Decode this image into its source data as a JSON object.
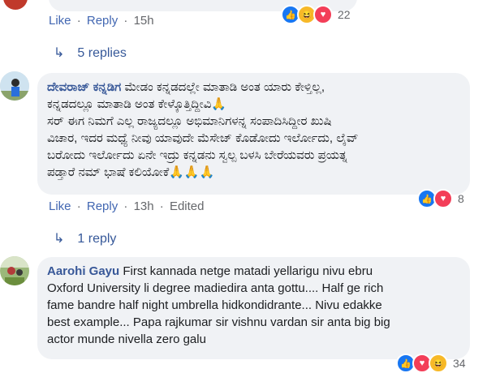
{
  "comment0": {
    "actions": {
      "like": "Like",
      "reply": "Reply",
      "time": "15h"
    },
    "reactions": {
      "count": "22",
      "types": [
        "like-icon",
        "haha-icon",
        "love-icon"
      ]
    },
    "replies_label": "5 replies"
  },
  "comment1": {
    "author": "ದೇವರಾಜ್ ಕನ್ನಡಿಗ",
    "line1": "ಮೇಡಂ ಕನ್ನಡದಲ್ಲೇ ಮಾತಾಡಿ ಅಂತ ಯಾರು ಕೇಳ್ತಿಲ್ಲ,",
    "line2": "ಕನ್ನಡದಲ್ಲೂ ಮಾತಾಡಿ ಅಂತ ಕೇಳ್ಕೊತ್ತಿದ್ದೀವಿ🙏",
    "line3": "ಸರ್ ಈಗ ನಿಮಗೆ ಎಲ್ಲ ರಾಜ್ಯದಲ್ಲೂ ಅಭಿಮಾನಿಗಳನ್ನ ಸಂಪಾದಿಸಿದ್ದೀರ ಖುಷಿ",
    "line4": "ವಿಚಾರ, ಇದರ ಮಧ್ಯೆ ನೀವು ಯಾವುದೇ ಮೆಸೇಜ್ ಕೊಡೋದು ಇರ್ಲೋದು, ಲೈವ್",
    "line5": "ಬರೋದು ಇರ್ಲೋದು ಏನೇ ಇದ್ರು ಕನ್ನಡನು ಸ್ವಲ್ಪ ಬಳಸಿ ಬೇರೆಯವರು ಪ್ರಯತ್ನ",
    "line6": "ಪಡ್ತಾರೆ ನಮ್ ಭಾಷೆ ಕಲಿಯೋಕೆ🙏🙏🙏",
    "actions": {
      "like": "Like",
      "reply": "Reply",
      "time": "13h",
      "edited": "Edited"
    },
    "reactions": {
      "count": "8",
      "types": [
        "like-icon",
        "love-icon"
      ]
    },
    "replies_label": "1 reply"
  },
  "comment2": {
    "author": "Aarohi Gayu",
    "line1": "First kannada netge matadi yellarigu nivu ebru",
    "line2": "Oxford University li degree madiedira anta gottu.... Half ge rich",
    "line3": "fame bandre half night umbrella hidkondidrante... Nivu edakke",
    "line4": "best example... Papa rajkumar sir vishnu vardan sir anta big big",
    "line5": "actor munde nivella zero galu",
    "reactions": {
      "count": "34",
      "types": [
        "like-icon",
        "love-icon",
        "haha-icon"
      ]
    }
  },
  "separator": "·",
  "colors": {
    "link": "#4267b2",
    "author": "#385898",
    "bubble": "#f0f2f5",
    "meta": "#65676b"
  }
}
